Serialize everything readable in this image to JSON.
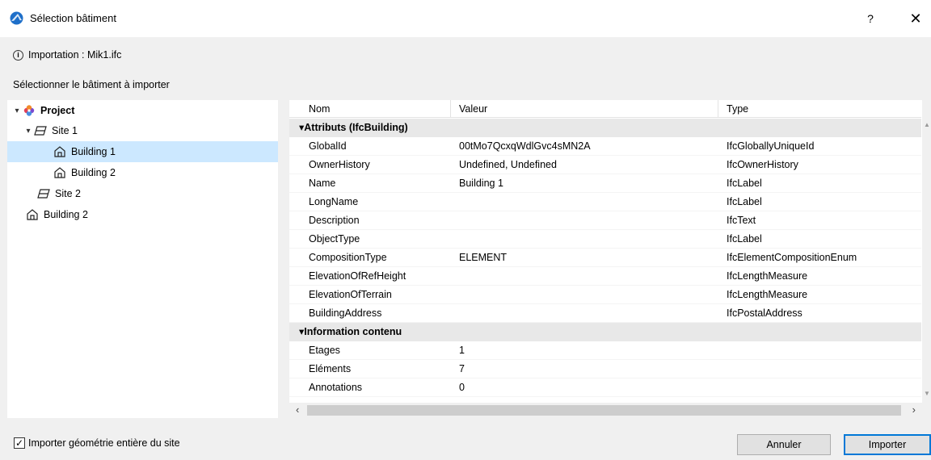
{
  "window": {
    "title": "Sélection bâtiment",
    "help_label": "?",
    "close_label": "✕"
  },
  "info": {
    "icon_label": "i",
    "text": "Importation : Mik1.ifc"
  },
  "tree": {
    "label": "Sélectionner le bâtiment à importer",
    "items": [
      {
        "label": "Project",
        "icon": "project-icon"
      },
      {
        "label": "Site 1",
        "icon": "site-icon"
      },
      {
        "label": "Building 1",
        "icon": "building-icon",
        "selected": true
      },
      {
        "label": "Building 2",
        "icon": "building-icon"
      },
      {
        "label": "Site 2",
        "icon": "site-icon"
      },
      {
        "label": "Building 2",
        "icon": "building-icon"
      }
    ]
  },
  "grid": {
    "columns": [
      "Nom",
      "Valeur",
      "Type"
    ],
    "groups": [
      {
        "label": "▾Attributs (IfcBuilding)",
        "rows": [
          {
            "name": "GlobalId",
            "value": "00tMo7QcxqWdlGvc4sMN2A",
            "type": "IfcGloballyUniqueId"
          },
          {
            "name": "OwnerHistory",
            "value": "Undefined, Undefined",
            "type": "IfcOwnerHistory"
          },
          {
            "name": "Name",
            "value": "Building 1",
            "type": "IfcLabel"
          },
          {
            "name": "LongName",
            "value": "",
            "type": "IfcLabel"
          },
          {
            "name": "Description",
            "value": "",
            "type": "IfcText"
          },
          {
            "name": "ObjectType",
            "value": "",
            "type": "IfcLabel"
          },
          {
            "name": "CompositionType",
            "value": "ELEMENT",
            "type": "IfcElementCompositionEnum"
          },
          {
            "name": "ElevationOfRefHeight",
            "value": "",
            "type": "IfcLengthMeasure"
          },
          {
            "name": "ElevationOfTerrain",
            "value": "",
            "type": "IfcLengthMeasure"
          },
          {
            "name": "BuildingAddress",
            "value": "",
            "type": "IfcPostalAddress"
          }
        ]
      },
      {
        "label": "▾Information contenu",
        "rows": [
          {
            "name": "Etages",
            "value": "1",
            "type": ""
          },
          {
            "name": "Eléments",
            "value": "7",
            "type": ""
          },
          {
            "name": "Annotations",
            "value": "0",
            "type": ""
          }
        ]
      }
    ]
  },
  "footer": {
    "checkbox_label": "Importer géométrie entière du site",
    "checkbox_checked": true,
    "cancel_label": "Annuler",
    "import_label": "Importer"
  },
  "colors": {
    "selection": "#cce8ff",
    "accent": "#0078d7",
    "group_bg": "#e8e8e8"
  }
}
